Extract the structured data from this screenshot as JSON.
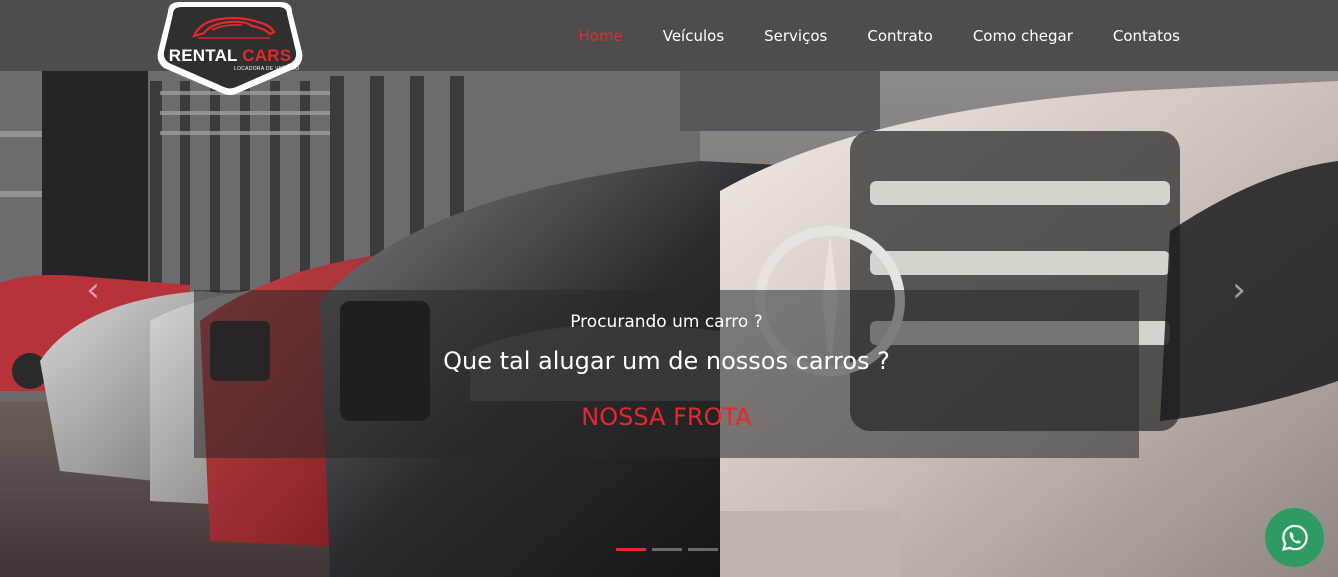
{
  "header": {
    "logo": {
      "brand_word1": "RENTAL",
      "brand_word2": "CARS",
      "tagline": "LOCADORA DE VEÍCULO"
    },
    "nav": [
      {
        "label": "Home",
        "active": true
      },
      {
        "label": "Veículos",
        "active": false
      },
      {
        "label": "Serviços",
        "active": false
      },
      {
        "label": "Contrato",
        "active": false
      },
      {
        "label": "Como chegar",
        "active": false
      },
      {
        "label": "Contatos",
        "active": false
      }
    ]
  },
  "hero": {
    "caption_line1": "Procurando um carro ?",
    "caption_line2": "Que tal alugar um de nossos carros ?",
    "cta_label": "NOSSA FROTA",
    "prev_icon": "‹",
    "next_icon": "›",
    "indicators_total": 3,
    "indicator_active": 1
  },
  "floating": {
    "icon": "whatsapp-icon"
  },
  "colors": {
    "accent": "#e8262d",
    "header_bg": "#4d4d4d",
    "whatsapp": "#2d9b63"
  }
}
